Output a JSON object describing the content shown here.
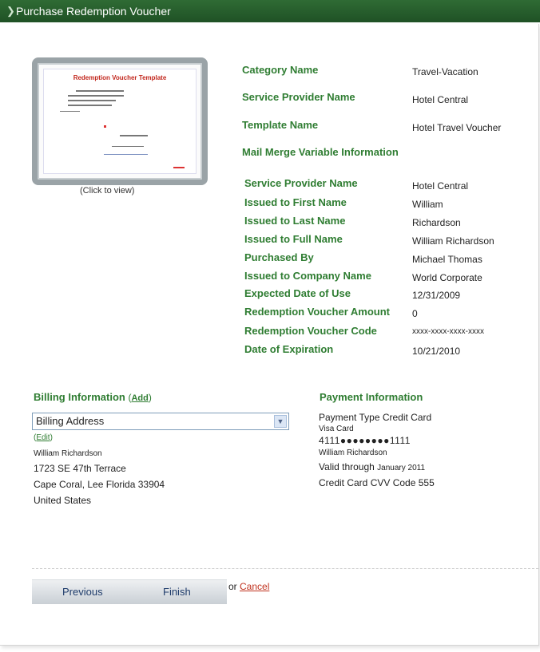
{
  "header": {
    "title": "Purchase Redemption Voucher",
    "chevron_icon": "chevron-right"
  },
  "thumbnail": {
    "caption": "(Click to view)",
    "template_title": "Redemption Voucher Template"
  },
  "details": [
    {
      "label": "Category Name",
      "value": "Travel-Vacation"
    },
    {
      "label": "Service Provider Name",
      "value": "Hotel Central"
    },
    {
      "label": "Template Name",
      "value": "Hotel Travel Voucher"
    }
  ],
  "mail_merge": {
    "title": "Mail Merge Variable Information",
    "rows": [
      {
        "label": "Service Provider Name",
        "value": "Hotel Central"
      },
      {
        "label": "Issued to First Name",
        "value": "William"
      },
      {
        "label": "Issued to Last Name",
        "value": "Richardson"
      },
      {
        "label": "Issued to Full Name",
        "value": "William Richardson"
      },
      {
        "label": "Purchased By",
        "value": "Michael Thomas"
      },
      {
        "label": "Issued to Company Name",
        "value": "World Corporate"
      },
      {
        "label": "Expected Date of Use",
        "value": "12/31/2009"
      },
      {
        "label": "Redemption Voucher Amount",
        "value": "0"
      },
      {
        "label": "Redemption Voucher Code",
        "value": "xxxx-xxxx-xxxx-xxxx"
      },
      {
        "label": "Date of Expiration",
        "value": "10/21/2010"
      }
    ]
  },
  "billing": {
    "title": "Billing Information",
    "add_label": "Add",
    "select_value": "Billing Address",
    "edit_label": "Edit",
    "name": "William Richardson",
    "street": "1723 SE 47th Terrace",
    "city_line": "Cape Coral, Lee Florida 33904",
    "country": "United States"
  },
  "payment": {
    "title": "Payment Information",
    "type_line": "Payment Type Credit Card",
    "card_type": "Visa Card",
    "card_number": "4111●●●●●●●●1111",
    "card_holder": "William Richardson",
    "valid_label": "Valid through",
    "valid_value": "January 2011",
    "cvv_line": "Credit Card CVV Code 555"
  },
  "actions": {
    "previous_label": "Previous",
    "finish_label": "Finish",
    "or_text": "or",
    "cancel_label": "Cancel"
  },
  "colors": {
    "header_green": "#1f5125",
    "label_green": "#2f7d32",
    "cancel_red": "#c0321f"
  }
}
